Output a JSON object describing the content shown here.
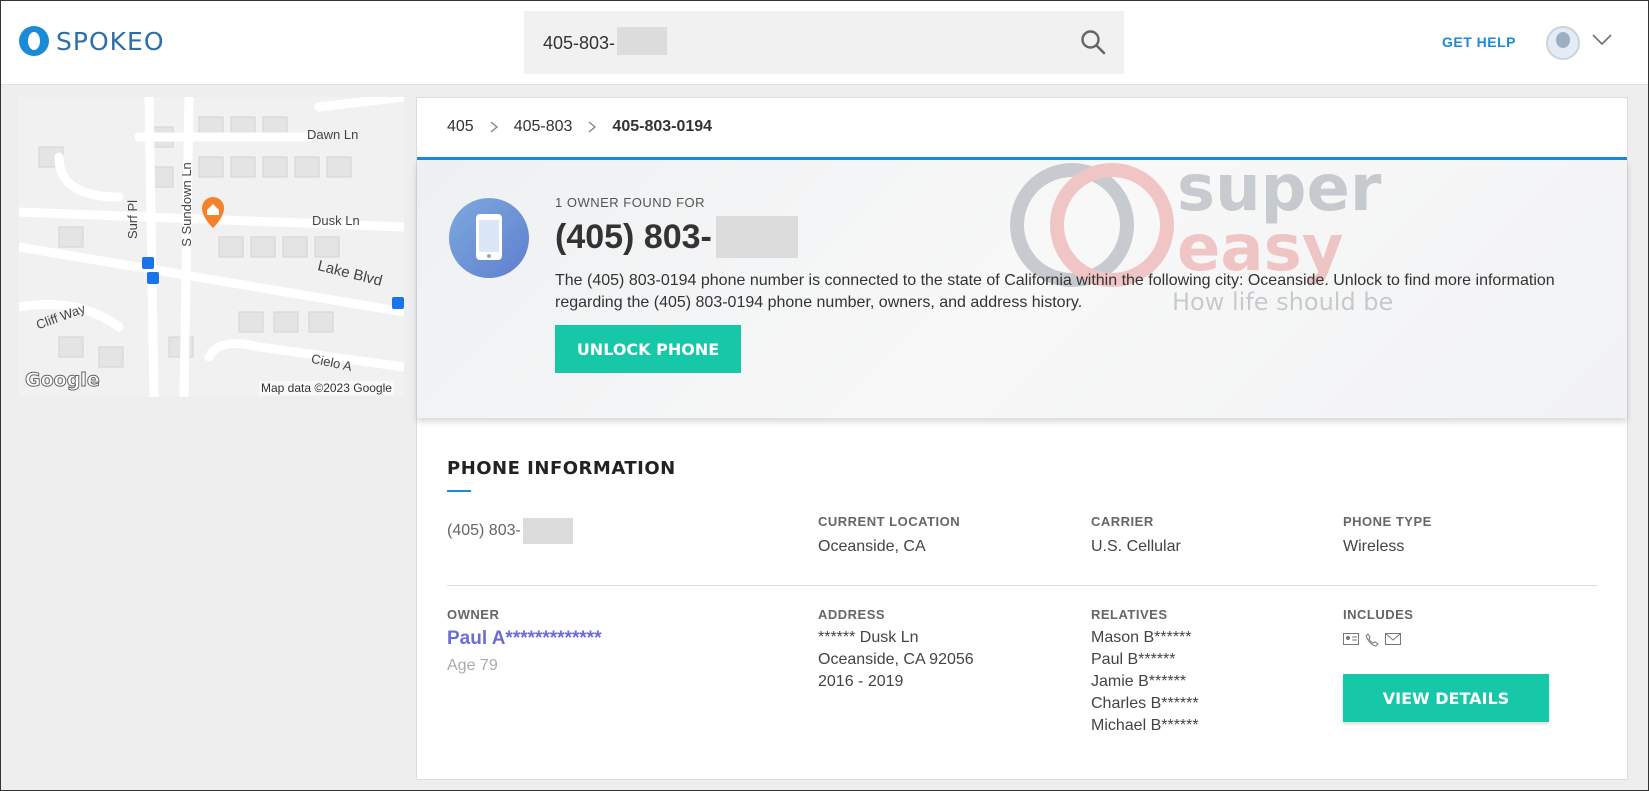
{
  "header": {
    "logo_text": "SPOKEO",
    "search_value": "405-803-",
    "get_help": "GET HELP"
  },
  "map": {
    "streets": [
      "Dawn Ln",
      "Dusk Ln",
      "Lake Blvd",
      "Surf Pl",
      "S Sundown Ln",
      "Cliff Way",
      "Cielo A"
    ],
    "google_logo": "Google",
    "credit": "Map data ©2023 Google"
  },
  "breadcrumb": [
    "405",
    "405-803",
    "405-803-0194"
  ],
  "hero": {
    "found_for": "1 OWNER FOUND FOR",
    "number": "(405) 803-",
    "description": "The (405) 803-0194 phone number is connected to the state of California within the following city: Oceanside. Unlock to find more information regarding the (405) 803-0194 phone number, owners, and address history.",
    "unlock_label": "UNLOCK PHONE"
  },
  "watermark": {
    "line1": "super",
    "line2": "easy",
    "tagline": "How life should be"
  },
  "phone_info": {
    "title": "PHONE INFORMATION",
    "number": "(405) 803-",
    "current_location_label": "CURRENT LOCATION",
    "current_location": "Oceanside, CA",
    "carrier_label": "CARRIER",
    "carrier": "U.S. Cellular",
    "phone_type_label": "PHONE TYPE",
    "phone_type": "Wireless"
  },
  "owner": {
    "owner_label": "OWNER",
    "name": "Paul A*************",
    "age": "Age 79",
    "address_label": "ADDRESS",
    "address": [
      "****** Dusk Ln",
      "Oceanside, CA 92056",
      "2016 - 2019"
    ],
    "relatives_label": "RELATIVES",
    "relatives": [
      "Mason B******",
      "Paul B******",
      "Jamie B******",
      "Charles B******",
      "Michael B******"
    ],
    "includes_label": "INCLUDES",
    "includes_icons": [
      "id-card-icon",
      "phone-icon",
      "email-icon"
    ],
    "view_label": "VIEW DETAILS"
  },
  "colors": {
    "accent_blue": "#1a8bd9",
    "button_teal": "#16c8a8",
    "owner_link": "#6c6cd8"
  }
}
